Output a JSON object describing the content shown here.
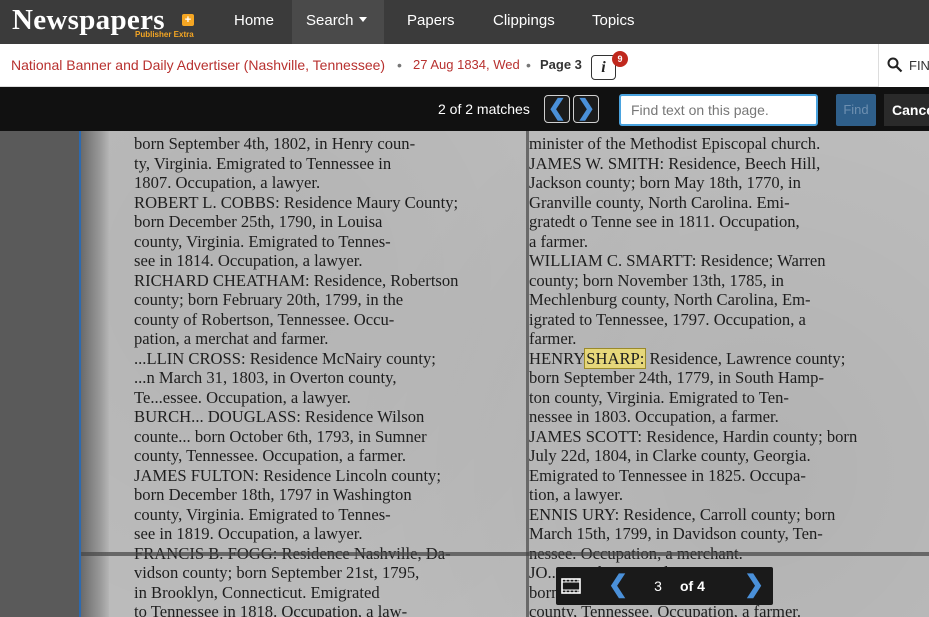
{
  "nav": {
    "logo": "Newspapers",
    "logo_badge": "+",
    "logo_sub": "Publisher Extra",
    "items": [
      {
        "label": "Home"
      },
      {
        "label": "Search"
      },
      {
        "label": "Papers"
      },
      {
        "label": "Clippings"
      },
      {
        "label": "Topics"
      }
    ]
  },
  "breadcrumb": {
    "publication": "National Banner and Daily Advertiser (Nashville, Tennessee)",
    "date": "27 Aug 1834, Wed",
    "page": "Page 3",
    "separator": "•",
    "info_icon": "i",
    "info_badge": "9",
    "find_label": "FIN"
  },
  "findbar": {
    "match_count": "2 of 2 matches",
    "prev": "❮",
    "next": "❯",
    "placeholder": "Find text on this page.",
    "find_label": "Find",
    "cancel_label": "Cance"
  },
  "article": {
    "left_lines": [
      "born September 4th, 1802, in Henry coun-",
      "ty, Virginia.  Emigrated to Tennessee in",
      "1807.  Occupation, a lawyer.",
      "ROBERT L. COBBS: Residence Maury County;",
      "born December 25th, 1790, in Louisa",
      "county, Virginia.  Emigrated to Tennes-",
      "see in 1814.  Occupation, a lawyer.",
      "RICHARD CHEATHAM: Residence, Robertson",
      "county; born February 20th, 1799, in the",
      "county of Robertson, Tennessee.  Occu-",
      "pation, a merchat and farmer.",
      "...LLIN CROSS: Residence McNairy county;",
      "...n March 31, 1803, in Overton county,",
      "Te...essee.  Occupation, a lawyer.",
      "BURCH...  DOUGLASS: Residence Wilson",
      "counte... born October 6th, 1793, in Sumner",
      "county, Tennessee.  Occupation, a farmer.",
      "JAMES FULTON: Residence Lincoln county;",
      "born December 18th, 1797 in Washington",
      "county, Virginia.  Emigrated to Tennes-",
      "see in 1819.  Occupation, a lawyer.",
      "FRANCIS B. FOGG: Residence Nashville, Da-",
      "vidson county; born September 21st, 1795,",
      "in Brooklyn, Connecticut.  Emigrated",
      "to Tennessee in 1818.  Occupation, a law-"
    ],
    "right_lines": [
      "minister of the Methodist Episcopal church.",
      "JAMES W. SMITH: Residence, Beech Hill,",
      "Jackson county; born May 18th, 1770, in",
      "Granville county, North Carolina.  Emi-",
      "gratedt o Tenne see in 1811.  Occupation,",
      "a farmer.",
      "WILLIAM C. SMARTT: Residence; Warren",
      "county; born November 13th, 1785, in",
      "Mechlenburg county, North Carolina, Em-",
      "igrated to Tennessee, 1797.  Occupation, a",
      "farmer.",
      "HENRY",
      "born September 24th, 1779, in South Hamp-",
      "ton county, Virginia.  Emigrated to Ten-",
      "nessee in 1803.  Occupation, a farmer.",
      "JAMES SCOTT: Residence, Hardin county; born",
      "July 22d, 1804, in Clarke county, Georgia.",
      "Emigrated to Tennessee in 1825.  Occupa-",
      "tion, a lawyer.",
      "ENNIS URY: Residence, Carroll county; born",
      "March 15th, 1799, in Davidson county, Ten-",
      "nessee.  Occupation, a merchant.",
      "JO...  Residence, Anderson county;",
      "born ...  20th, 1796, in Washington",
      "county, Tennessee.  Occupation, a farmer."
    ],
    "match_word": "SHARP:",
    "match_after": " Residence, Lawrence county;"
  },
  "pagenav": {
    "prev": "❮",
    "next": "❯",
    "current": "3",
    "total_label": "of 4"
  }
}
